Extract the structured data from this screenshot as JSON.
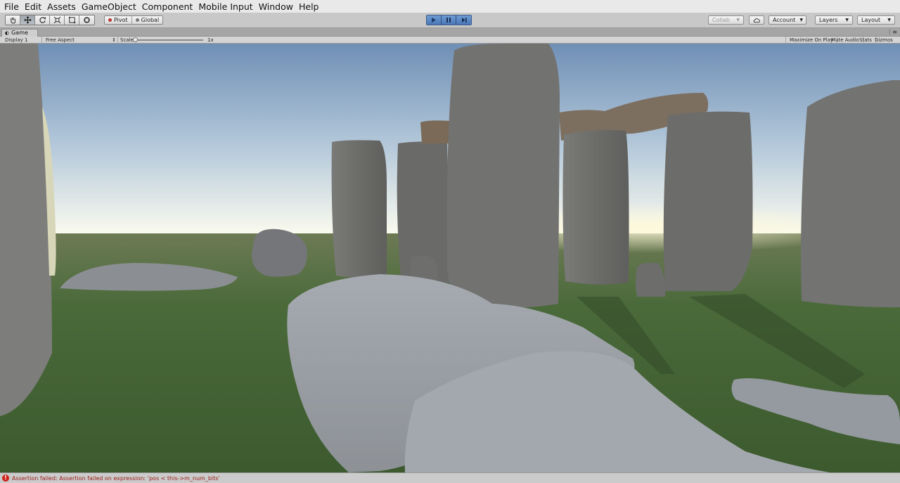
{
  "menu": [
    "File",
    "Edit",
    "Assets",
    "GameObject",
    "Component",
    "Mobile Input",
    "Window",
    "Help"
  ],
  "toolbar": {
    "tools": [
      "hand-tool",
      "move-tool",
      "rotate-tool",
      "scale-tool",
      "rect-tool",
      "transform-tool"
    ],
    "pivot_label": "Pivot",
    "global_label": "Global",
    "collab_label": "Collab",
    "account_label": "Account",
    "layers_label": "Layers",
    "layout_label": "Layout",
    "play_state": "playing"
  },
  "game_view": {
    "tab_label": "Game",
    "display_label": "Display 1",
    "aspect_label": "Free Aspect",
    "scale_label": "Scale",
    "scale_value": "1x",
    "maximize_label": "Maximize On Play",
    "mute_label": "Mute Audio",
    "stats_label": "Stats",
    "gizmos_label": "Gizmos"
  },
  "status": {
    "message": "Assertion failed: Assertion failed on expression: 'pos < this->m_num_bits'"
  },
  "colors": {
    "sky_top": "#6f8fb5",
    "sky_horizon": "#fbfbef",
    "grass": "#4a6a3a",
    "stone": "#6f6f6c",
    "stone_light": "#b8bcc0",
    "error": "#d0211d",
    "play_active": "#4a78b8"
  }
}
